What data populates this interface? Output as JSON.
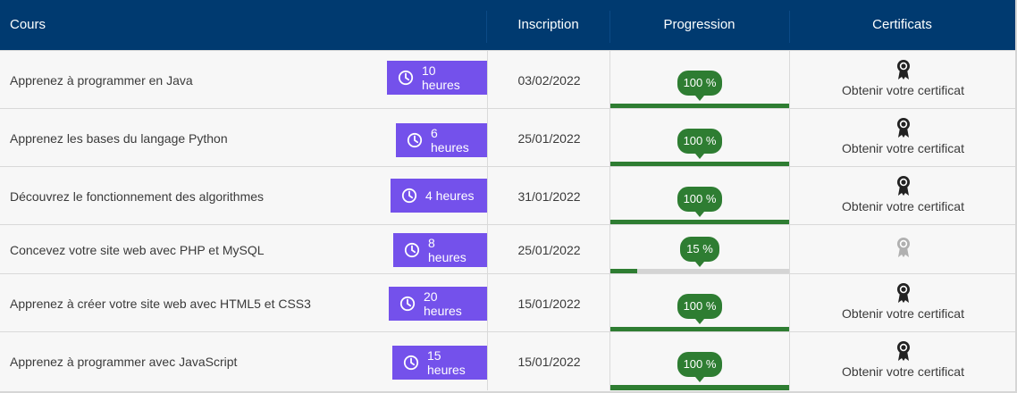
{
  "header": {
    "course": "Cours",
    "inscription": "Inscription",
    "progression": "Progression",
    "certificats": "Certificats"
  },
  "colors": {
    "header_bg": "#003a70",
    "duration_bg": "#7451eb",
    "progress_green": "#2e7d32",
    "progress_track": "#d4d4d4"
  },
  "rows": [
    {
      "title": "Apprenez à programmer en Java",
      "duration": "10 heures",
      "date": "03/02/2022",
      "progress_label": "100 %",
      "progress": 1.0,
      "certified": true,
      "cert_text": "Obtenir votre certificat"
    },
    {
      "title": "Apprenez les bases du langage Python",
      "duration": "6 heures",
      "date": "25/01/2022",
      "progress_label": "100 %",
      "progress": 1.0,
      "certified": true,
      "cert_text": "Obtenir votre certificat"
    },
    {
      "title": "Découvrez le fonctionnement des algorithmes",
      "duration": "4 heures",
      "date": "31/01/2022",
      "progress_label": "100 %",
      "progress": 1.0,
      "certified": true,
      "cert_text": "Obtenir votre certificat"
    },
    {
      "title": "Concevez votre site web avec PHP et MySQL",
      "duration": "8 heures",
      "date": "25/01/2022",
      "progress_label": "15 %",
      "progress": 0.15,
      "certified": false,
      "cert_text": ""
    },
    {
      "title": "Apprenez à créer votre site web avec HTML5 et CSS3",
      "duration": "20 heures",
      "date": "15/01/2022",
      "progress_label": "100 %",
      "progress": 1.0,
      "certified": true,
      "cert_text": "Obtenir votre certificat"
    },
    {
      "title": "Apprenez à programmer avec JavaScript",
      "duration": "15 heures",
      "date": "15/01/2022",
      "progress_label": "100 %",
      "progress": 1.0,
      "certified": true,
      "cert_text": "Obtenir votre certificat"
    }
  ]
}
